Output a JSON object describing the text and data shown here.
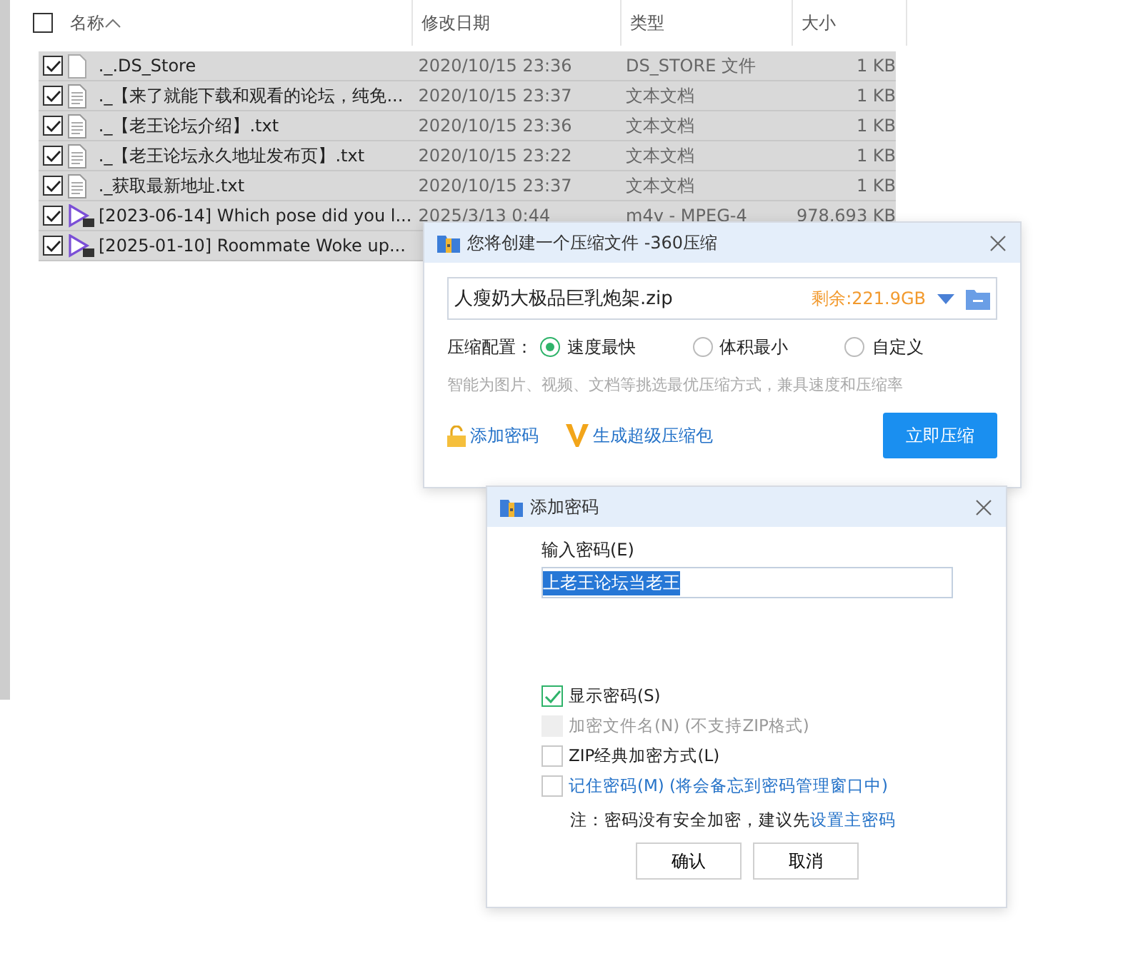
{
  "explorer": {
    "columns": [
      "名称",
      "修改日期",
      "类型",
      "大小"
    ],
    "all_checked": false,
    "rows": [
      {
        "kind": "blank",
        "name": "._.DS_Store",
        "date": "2020/10/15 23:36",
        "type": "DS_STORE 文件",
        "size": "1 KB",
        "checked": true,
        "selected": true
      },
      {
        "kind": "text",
        "name": "._【来了就能下载和观看的论坛，纯免...",
        "date": "2020/10/15 23:37",
        "type": "文本文档",
        "size": "1 KB",
        "checked": true,
        "selected": true
      },
      {
        "kind": "text",
        "name": "._【老王论坛介绍】.txt",
        "date": "2020/10/15 23:36",
        "type": "文本文档",
        "size": "1 KB",
        "checked": true,
        "selected": true
      },
      {
        "kind": "text",
        "name": "._【老王论坛永久地址发布页】.txt",
        "date": "2020/10/15 23:22",
        "type": "文本文档",
        "size": "1 KB",
        "checked": true,
        "selected": true
      },
      {
        "kind": "text",
        "name": "._获取最新地址.txt",
        "date": "2020/10/15 23:37",
        "type": "文本文档",
        "size": "1 KB",
        "checked": true,
        "selected": true
      },
      {
        "kind": "video",
        "name": "[2023-06-14] Which pose did you l...",
        "date": "2025/3/13 0:44",
        "type": "m4v - MPEG-4",
        "size": "978,693 KB",
        "checked": true,
        "selected": true
      },
      {
        "kind": "video",
        "name": "[2025-01-10] Roommate Woke up...",
        "checked": true,
        "selected": true
      }
    ]
  },
  "compress_dialog": {
    "title": "您将创建一个压缩文件 -360压缩",
    "filename": "人瘦奶大极品巨乳炮架.zip",
    "free_space": "剩余:221.9GB",
    "config_label": "压缩配置：",
    "options": [
      {
        "label": "速度最快",
        "selected": true
      },
      {
        "label": "体积最小",
        "selected": false
      },
      {
        "label": "自定义",
        "selected": false
      }
    ],
    "hint": "智能为图片、视频、文档等挑选最优压缩方式，兼具速度和压缩率",
    "add_password": "添加密码",
    "super_pack": "生成超级压缩包",
    "compress_button": "立即压缩"
  },
  "password_dialog": {
    "title": "添加密码",
    "input_label": "输入密码(E)",
    "password": "上老王论坛当老王",
    "options": [
      {
        "label": "显示密码(S)",
        "checked": true,
        "disabled": false,
        "link": false
      },
      {
        "label": "加密文件名(N) (不支持ZIP格式)",
        "checked": false,
        "disabled": true,
        "link": false
      },
      {
        "label": "ZIP经典加密方式(L)",
        "checked": false,
        "disabled": false,
        "link": false
      },
      {
        "label": "记住密码(M) (将会备忘到密码管理窗口中)",
        "checked": false,
        "disabled": false,
        "link": true
      }
    ],
    "note": "注：密码没有安全加密，建议先",
    "note_link": "设置主密码",
    "buttons": [
      "确认",
      "取消"
    ]
  }
}
